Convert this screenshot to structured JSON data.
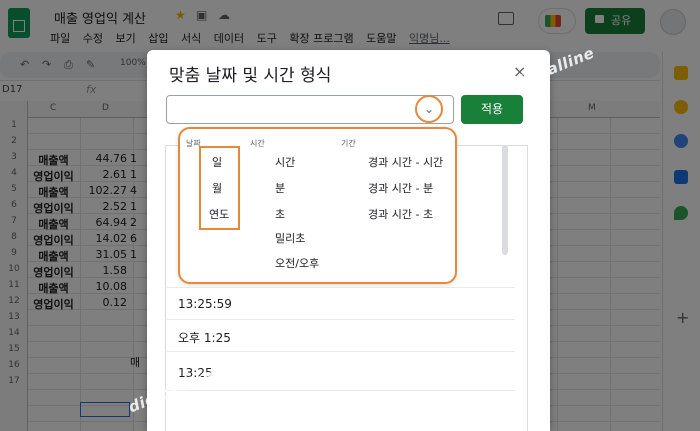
{
  "app": {
    "doc_title": "매출 영업익 계산",
    "menu": [
      "파일",
      "수정",
      "보기",
      "삽입",
      "서식",
      "데이터",
      "도구",
      "확장 프로그램",
      "도움말"
    ],
    "menu_user": "익명님...",
    "share_label": "공유",
    "zoom": "100%",
    "name_box": "D17",
    "fx": "fx"
  },
  "grid": {
    "columns": [
      "C",
      "D",
      "M"
    ],
    "rows": [
      "1",
      "2",
      "3",
      "4",
      "5",
      "6",
      "7",
      "8",
      "9",
      "10",
      "11",
      "12",
      "13",
      "14",
      "15",
      "16",
      "17"
    ],
    "cells": [
      {
        "a": "매출액",
        "b": "44.76",
        "c": "1"
      },
      {
        "a": "영업이익",
        "b": "2.61",
        "c": "1"
      },
      {
        "a": "매출액",
        "b": "102.27",
        "c": "4"
      },
      {
        "a": "영업이익",
        "b": "2.52",
        "c": "1"
      },
      {
        "a": "매출액",
        "b": "64.94",
        "c": "2"
      },
      {
        "a": "영업이익",
        "b": "14.02",
        "c": "6"
      },
      {
        "a": "매출액",
        "b": "31.05",
        "c": "1"
      },
      {
        "a": "영업이익",
        "b": "1.58",
        "c": ""
      },
      {
        "a": "매출액",
        "b": "10.08",
        "c": ""
      },
      {
        "a": "영업이익",
        "b": "0.12",
        "c": ""
      }
    ],
    "row14_text": "매"
  },
  "dialog": {
    "title": "맞춤 날짜 및 시간 형식",
    "close": "×",
    "input_value": "",
    "apply_label": "적용",
    "list": [
      "13:25:59",
      "오후 1:25",
      "13:25"
    ]
  },
  "menu": {
    "date_header": "날짜",
    "time_header": "시간",
    "duration_header": "기간",
    "date_items": [
      "일",
      "월",
      "연도"
    ],
    "time_items": [
      "시간",
      "분",
      "초",
      "밀리초",
      "오전/오후"
    ],
    "duration_items": [
      "경과 시간 - 시간",
      "경과 시간 - 분",
      "경과 시간 - 초"
    ]
  },
  "watermark": "digitalline",
  "colors": {
    "accent_green": "#188038",
    "highlight_orange": "#e8883a"
  },
  "icons": [
    "sheets-logo-icon",
    "star-icon",
    "folder-icon",
    "cloud-icon",
    "comment-icon",
    "meet-icon",
    "lock-icon",
    "chevron-down-icon",
    "close-icon"
  ]
}
